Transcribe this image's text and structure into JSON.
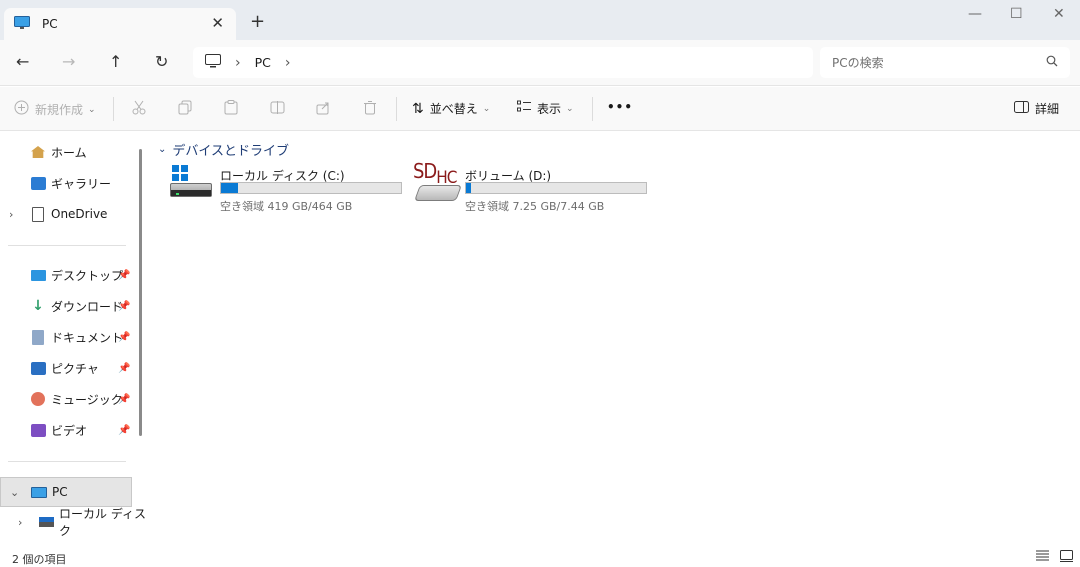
{
  "tab": {
    "icon": "monitor-icon",
    "title": "PC",
    "close": "✕"
  },
  "new_tab": "+",
  "window_controls": {
    "minimize": "—",
    "maximize": "☐",
    "close": "✕"
  },
  "nav": {
    "back": "←",
    "forward": "→",
    "up": "↑",
    "refresh": "↻"
  },
  "address": {
    "icon": "monitor-icon",
    "sep1": "›",
    "crumb": "PC",
    "sep2": "›"
  },
  "search": {
    "placeholder": "PCの検索",
    "icon": "search-icon"
  },
  "commands": {
    "new": "新規作成",
    "sort": "並べ替え",
    "view": "表示",
    "more": "•••",
    "details": "詳細"
  },
  "sidebar": {
    "home": "ホーム",
    "gallery": "ギャラリー",
    "onedrive": "OneDrive",
    "quick": [
      {
        "label": "デスクトップ",
        "icon": "desktop-icon"
      },
      {
        "label": "ダウンロード",
        "icon": "download-icon"
      },
      {
        "label": "ドキュメント",
        "icon": "documents-icon"
      },
      {
        "label": "ピクチャ",
        "icon": "pictures-icon"
      },
      {
        "label": "ミュージック",
        "icon": "music-icon"
      },
      {
        "label": "ビデオ",
        "icon": "videos-icon"
      }
    ],
    "pc": "PC",
    "local_disk": "ローカル ディスク"
  },
  "content": {
    "group": "デバイスとドライブ",
    "drives": [
      {
        "name": "ローカル ディスク (C:)",
        "free": "空き領域 419 GB/464 GB",
        "used_fraction": 0.097,
        "icon": "hard-drive-icon"
      },
      {
        "name": "ボリューム (D:)",
        "free": "空き領域 7.25 GB/7.44 GB",
        "used_fraction": 0.026,
        "icon": "sdhc-card-icon",
        "logo_sd": "SD",
        "logo_hc": "HC"
      }
    ]
  },
  "status": {
    "count": "2 個の項目"
  },
  "colors": {
    "accent": "#0a7ad4",
    "group_header": "#1f3d76",
    "titlebar": "#e8ecf1"
  }
}
